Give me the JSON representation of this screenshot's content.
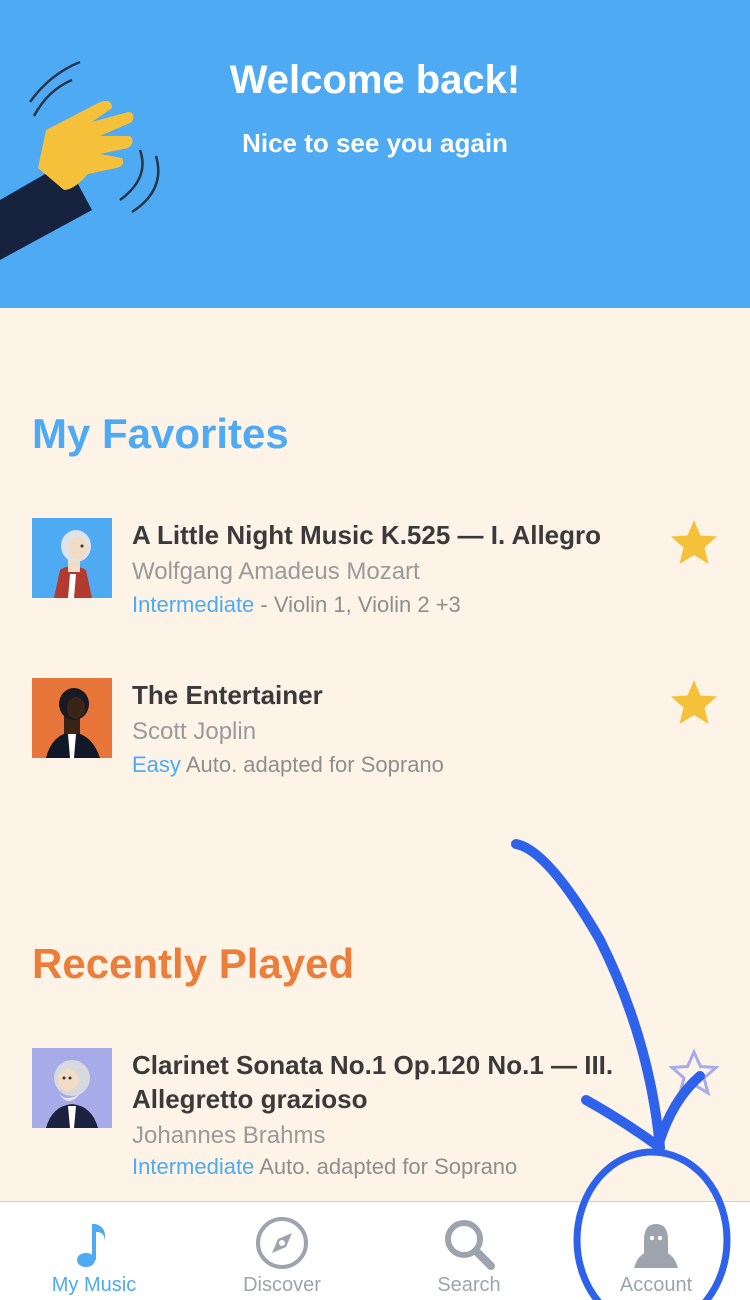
{
  "header": {
    "title": "Welcome back!",
    "subtitle": "Nice to see you again",
    "bg_color": "#4eaaf3",
    "illustration_icon": "waving-hand-icon"
  },
  "favorites": {
    "title": "My Favorites",
    "items": [
      {
        "title": "A Little Night Music K.525 — I. Allegro",
        "composer": "Wolfgang Amadeus Mozart",
        "level": "Intermediate",
        "detail": " - Violin 1, Violin 2 +3",
        "favorite": true
      },
      {
        "title": "The Entertainer",
        "composer": "Scott Joplin",
        "level": "Easy",
        "detail": " Auto. adapted for Soprano",
        "favorite": true
      }
    ]
  },
  "recent": {
    "title": "Recently Played",
    "items": [
      {
        "title": "Clarinet Sonata No.1 Op.120 No.1 — III. Allegretto grazioso",
        "composer": "Johannes Brahms",
        "level": "Intermediate",
        "detail": " Auto. adapted for Soprano",
        "favorite": false
      }
    ]
  },
  "tabs": [
    {
      "label": "My Music",
      "icon": "music-note-icon",
      "active": true
    },
    {
      "label": "Discover",
      "icon": "compass-icon",
      "active": false
    },
    {
      "label": "Search",
      "icon": "search-icon",
      "active": false
    },
    {
      "label": "Account",
      "icon": "account-icon",
      "active": false
    }
  ],
  "colors": {
    "accent_blue": "#4eaaf3",
    "accent_orange": "#ea7e3a",
    "star_gold": "#f5c03a",
    "background": "#fdf3e7",
    "annotation": "#2f62ea"
  }
}
